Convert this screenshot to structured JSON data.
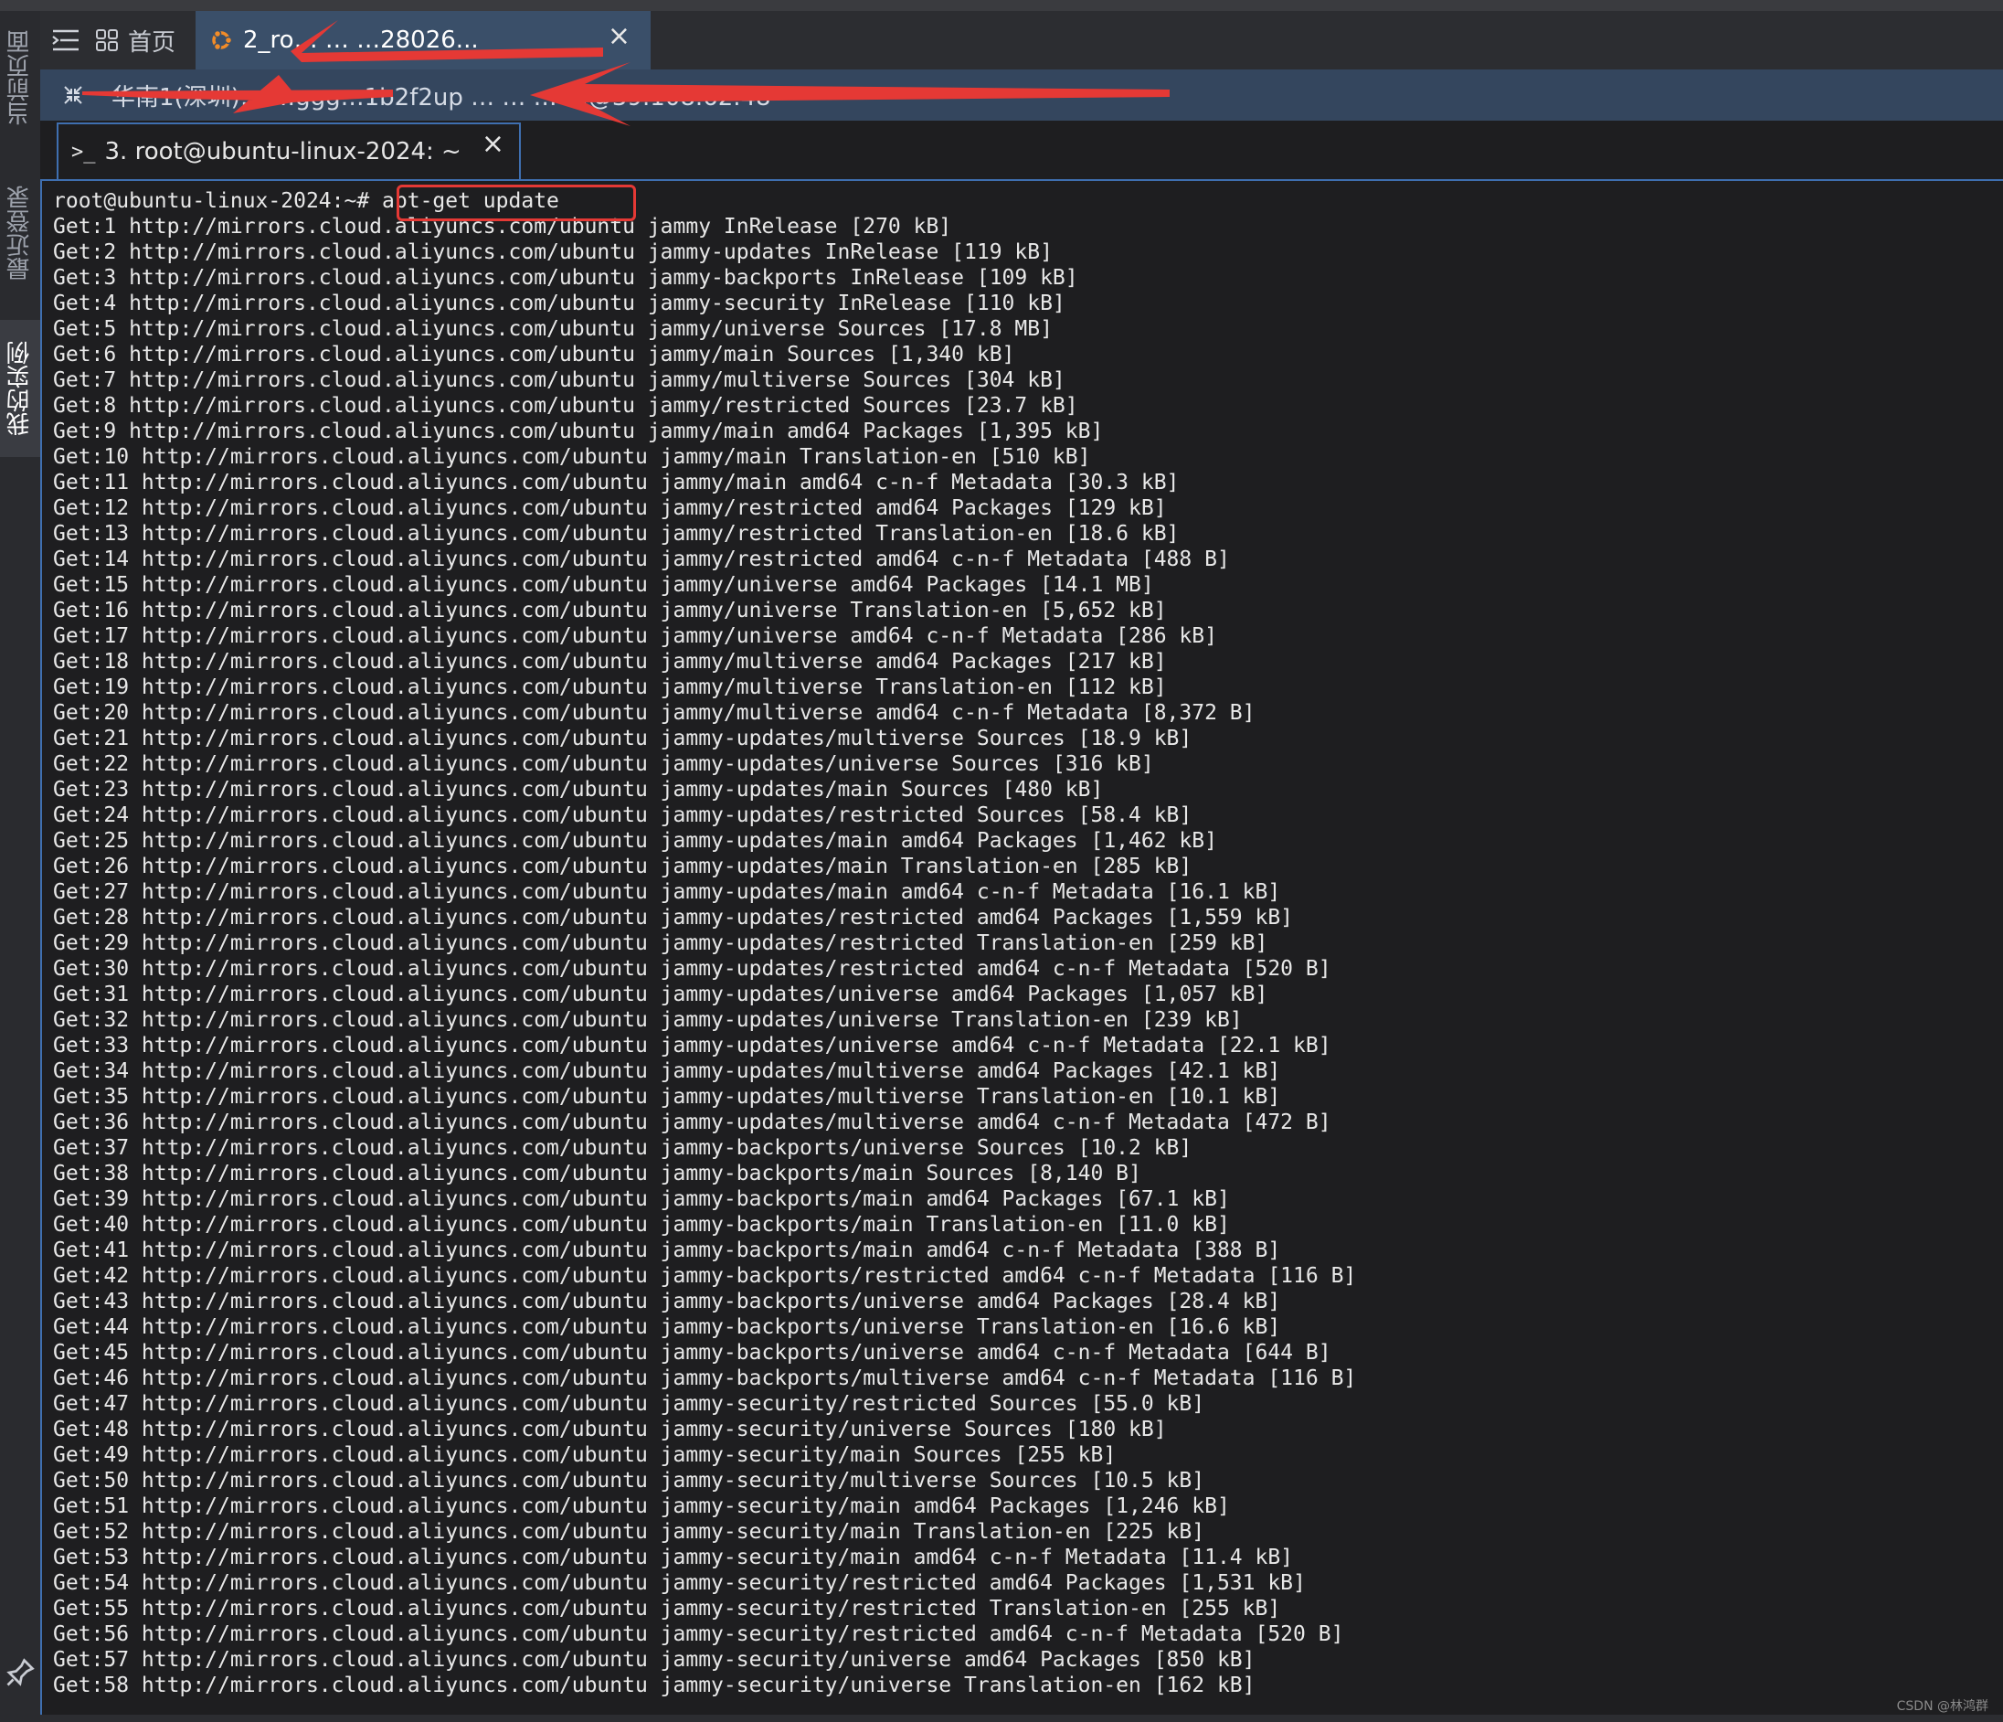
{
  "sidebar": {
    "tabs": [
      "当前页面",
      "最近登录",
      "我的实例"
    ],
    "active": 2
  },
  "topbar": {
    "home_label": "首页",
    "session_tab_title": "2_ro…   …   …28026...",
    "session_close": "×"
  },
  "connection": {
    "text": "华南1(深圳)… …ggg…1b2f2up … …  … …@39.108.62.48"
  },
  "terminal_tab": {
    "label": "3. root@ubuntu-linux-2024: ~",
    "close": "×"
  },
  "terminal": {
    "prompt": "root@ubuntu-linux-2024:~# ",
    "command": "apt-get update",
    "lines": [
      "Get:1 http://mirrors.cloud.aliyuncs.com/ubuntu jammy InRelease [270 kB]",
      "Get:2 http://mirrors.cloud.aliyuncs.com/ubuntu jammy-updates InRelease [119 kB]",
      "Get:3 http://mirrors.cloud.aliyuncs.com/ubuntu jammy-backports InRelease [109 kB]",
      "Get:4 http://mirrors.cloud.aliyuncs.com/ubuntu jammy-security InRelease [110 kB]",
      "Get:5 http://mirrors.cloud.aliyuncs.com/ubuntu jammy/universe Sources [17.8 MB]",
      "Get:6 http://mirrors.cloud.aliyuncs.com/ubuntu jammy/main Sources [1,340 kB]",
      "Get:7 http://mirrors.cloud.aliyuncs.com/ubuntu jammy/multiverse Sources [304 kB]",
      "Get:8 http://mirrors.cloud.aliyuncs.com/ubuntu jammy/restricted Sources [23.7 kB]",
      "Get:9 http://mirrors.cloud.aliyuncs.com/ubuntu jammy/main amd64 Packages [1,395 kB]",
      "Get:10 http://mirrors.cloud.aliyuncs.com/ubuntu jammy/main Translation-en [510 kB]",
      "Get:11 http://mirrors.cloud.aliyuncs.com/ubuntu jammy/main amd64 c-n-f Metadata [30.3 kB]",
      "Get:12 http://mirrors.cloud.aliyuncs.com/ubuntu jammy/restricted amd64 Packages [129 kB]",
      "Get:13 http://mirrors.cloud.aliyuncs.com/ubuntu jammy/restricted Translation-en [18.6 kB]",
      "Get:14 http://mirrors.cloud.aliyuncs.com/ubuntu jammy/restricted amd64 c-n-f Metadata [488 B]",
      "Get:15 http://mirrors.cloud.aliyuncs.com/ubuntu jammy/universe amd64 Packages [14.1 MB]",
      "Get:16 http://mirrors.cloud.aliyuncs.com/ubuntu jammy/universe Translation-en [5,652 kB]",
      "Get:17 http://mirrors.cloud.aliyuncs.com/ubuntu jammy/universe amd64 c-n-f Metadata [286 kB]",
      "Get:18 http://mirrors.cloud.aliyuncs.com/ubuntu jammy/multiverse amd64 Packages [217 kB]",
      "Get:19 http://mirrors.cloud.aliyuncs.com/ubuntu jammy/multiverse Translation-en [112 kB]",
      "Get:20 http://mirrors.cloud.aliyuncs.com/ubuntu jammy/multiverse amd64 c-n-f Metadata [8,372 B]",
      "Get:21 http://mirrors.cloud.aliyuncs.com/ubuntu jammy-updates/multiverse Sources [18.9 kB]",
      "Get:22 http://mirrors.cloud.aliyuncs.com/ubuntu jammy-updates/universe Sources [316 kB]",
      "Get:23 http://mirrors.cloud.aliyuncs.com/ubuntu jammy-updates/main Sources [480 kB]",
      "Get:24 http://mirrors.cloud.aliyuncs.com/ubuntu jammy-updates/restricted Sources [58.4 kB]",
      "Get:25 http://mirrors.cloud.aliyuncs.com/ubuntu jammy-updates/main amd64 Packages [1,462 kB]",
      "Get:26 http://mirrors.cloud.aliyuncs.com/ubuntu jammy-updates/main Translation-en [285 kB]",
      "Get:27 http://mirrors.cloud.aliyuncs.com/ubuntu jammy-updates/main amd64 c-n-f Metadata [16.1 kB]",
      "Get:28 http://mirrors.cloud.aliyuncs.com/ubuntu jammy-updates/restricted amd64 Packages [1,559 kB]",
      "Get:29 http://mirrors.cloud.aliyuncs.com/ubuntu jammy-updates/restricted Translation-en [259 kB]",
      "Get:30 http://mirrors.cloud.aliyuncs.com/ubuntu jammy-updates/restricted amd64 c-n-f Metadata [520 B]",
      "Get:31 http://mirrors.cloud.aliyuncs.com/ubuntu jammy-updates/universe amd64 Packages [1,057 kB]",
      "Get:32 http://mirrors.cloud.aliyuncs.com/ubuntu jammy-updates/universe Translation-en [239 kB]",
      "Get:33 http://mirrors.cloud.aliyuncs.com/ubuntu jammy-updates/universe amd64 c-n-f Metadata [22.1 kB]",
      "Get:34 http://mirrors.cloud.aliyuncs.com/ubuntu jammy-updates/multiverse amd64 Packages [42.1 kB]",
      "Get:35 http://mirrors.cloud.aliyuncs.com/ubuntu jammy-updates/multiverse Translation-en [10.1 kB]",
      "Get:36 http://mirrors.cloud.aliyuncs.com/ubuntu jammy-updates/multiverse amd64 c-n-f Metadata [472 B]",
      "Get:37 http://mirrors.cloud.aliyuncs.com/ubuntu jammy-backports/universe Sources [10.2 kB]",
      "Get:38 http://mirrors.cloud.aliyuncs.com/ubuntu jammy-backports/main Sources [8,140 B]",
      "Get:39 http://mirrors.cloud.aliyuncs.com/ubuntu jammy-backports/main amd64 Packages [67.1 kB]",
      "Get:40 http://mirrors.cloud.aliyuncs.com/ubuntu jammy-backports/main Translation-en [11.0 kB]",
      "Get:41 http://mirrors.cloud.aliyuncs.com/ubuntu jammy-backports/main amd64 c-n-f Metadata [388 B]",
      "Get:42 http://mirrors.cloud.aliyuncs.com/ubuntu jammy-backports/restricted amd64 c-n-f Metadata [116 B]",
      "Get:43 http://mirrors.cloud.aliyuncs.com/ubuntu jammy-backports/universe amd64 Packages [28.4 kB]",
      "Get:44 http://mirrors.cloud.aliyuncs.com/ubuntu jammy-backports/universe Translation-en [16.6 kB]",
      "Get:45 http://mirrors.cloud.aliyuncs.com/ubuntu jammy-backports/universe amd64 c-n-f Metadata [644 B]",
      "Get:46 http://mirrors.cloud.aliyuncs.com/ubuntu jammy-backports/multiverse amd64 c-n-f Metadata [116 B]",
      "Get:47 http://mirrors.cloud.aliyuncs.com/ubuntu jammy-security/restricted Sources [55.0 kB]",
      "Get:48 http://mirrors.cloud.aliyuncs.com/ubuntu jammy-security/universe Sources [180 kB]",
      "Get:49 http://mirrors.cloud.aliyuncs.com/ubuntu jammy-security/main Sources [255 kB]",
      "Get:50 http://mirrors.cloud.aliyuncs.com/ubuntu jammy-security/multiverse Sources [10.5 kB]",
      "Get:51 http://mirrors.cloud.aliyuncs.com/ubuntu jammy-security/main amd64 Packages [1,246 kB]",
      "Get:52 http://mirrors.cloud.aliyuncs.com/ubuntu jammy-security/main Translation-en [225 kB]",
      "Get:53 http://mirrors.cloud.aliyuncs.com/ubuntu jammy-security/main amd64 c-n-f Metadata [11.4 kB]",
      "Get:54 http://mirrors.cloud.aliyuncs.com/ubuntu jammy-security/restricted amd64 Packages [1,531 kB]",
      "Get:55 http://mirrors.cloud.aliyuncs.com/ubuntu jammy-security/restricted Translation-en [255 kB]",
      "Get:56 http://mirrors.cloud.aliyuncs.com/ubuntu jammy-security/restricted amd64 c-n-f Metadata [520 B]",
      "Get:57 http://mirrors.cloud.aliyuncs.com/ubuntu jammy-security/universe amd64 Packages [850 kB]",
      "Get:58 http://mirrors.cloud.aliyuncs.com/ubuntu jammy-security/universe Translation-en [162 kB]"
    ]
  },
  "watermark": "CSDN @林鸿群",
  "colors": {
    "background": "#1e1e20",
    "active_tab": "#3a4f69",
    "connection_bar": "#34465e",
    "focus_border": "#3f6fb0",
    "annotation": "#e53935"
  },
  "icons": [
    "menu-icon",
    "home-grid-icon",
    "ubuntu-icon",
    "collapse-icon",
    "terminal-prompt-icon",
    "pin-icon",
    "close-icon"
  ]
}
